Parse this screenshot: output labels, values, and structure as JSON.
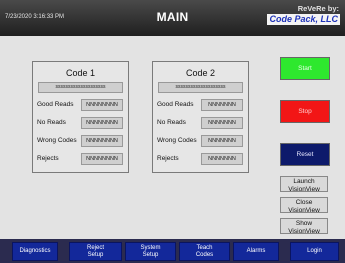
{
  "header": {
    "timestamp": "7/23/2020 3:16:33 PM",
    "title": "MAIN",
    "brand_line1": "ReVeRe by:",
    "brand_line2": "Code Pack, LLC"
  },
  "panels": [
    {
      "title": "Code 1",
      "code": "ssssssssssssssssssss",
      "rows": [
        {
          "label": "Good Reads",
          "value": "NNNNNNNN"
        },
        {
          "label": "No Reads",
          "value": "NNNNNNNN"
        },
        {
          "label": "Wrong Codes",
          "value": "NNNNNNNN"
        },
        {
          "label": "Rejects",
          "value": "NNNNNNNN"
        }
      ]
    },
    {
      "title": "Code 2",
      "code": "ssssssssssssssssssss",
      "rows": [
        {
          "label": "Good Reads",
          "value": "NNNNNNN"
        },
        {
          "label": "No Reads",
          "value": "NNNNNNN"
        },
        {
          "label": "Wrong Codes",
          "value": "NNNNNNN"
        },
        {
          "label": "Rejects",
          "value": "NNNNNNN"
        }
      ]
    }
  ],
  "controls": {
    "start": "Start",
    "stop": "Stop",
    "reset": "Reset",
    "launch_1": "Launch",
    "launch_2": "VisionView",
    "close_1": "Close",
    "close_2": "VisionView",
    "show_1": "Show",
    "show_2": "VisionView"
  },
  "nav": {
    "diagnostics": "Diagnostics",
    "reject_1": "Reject",
    "reject_2": "Setup",
    "system_1": "System",
    "system_2": "Setup",
    "teach_1": "Teach",
    "teach_2": "Codes",
    "alarms": "Alarms",
    "login": "Login"
  },
  "colors": {
    "start": "#2ee82e",
    "stop": "#f21616",
    "reset": "#0d1a6b",
    "nav_button": "#13289a"
  }
}
